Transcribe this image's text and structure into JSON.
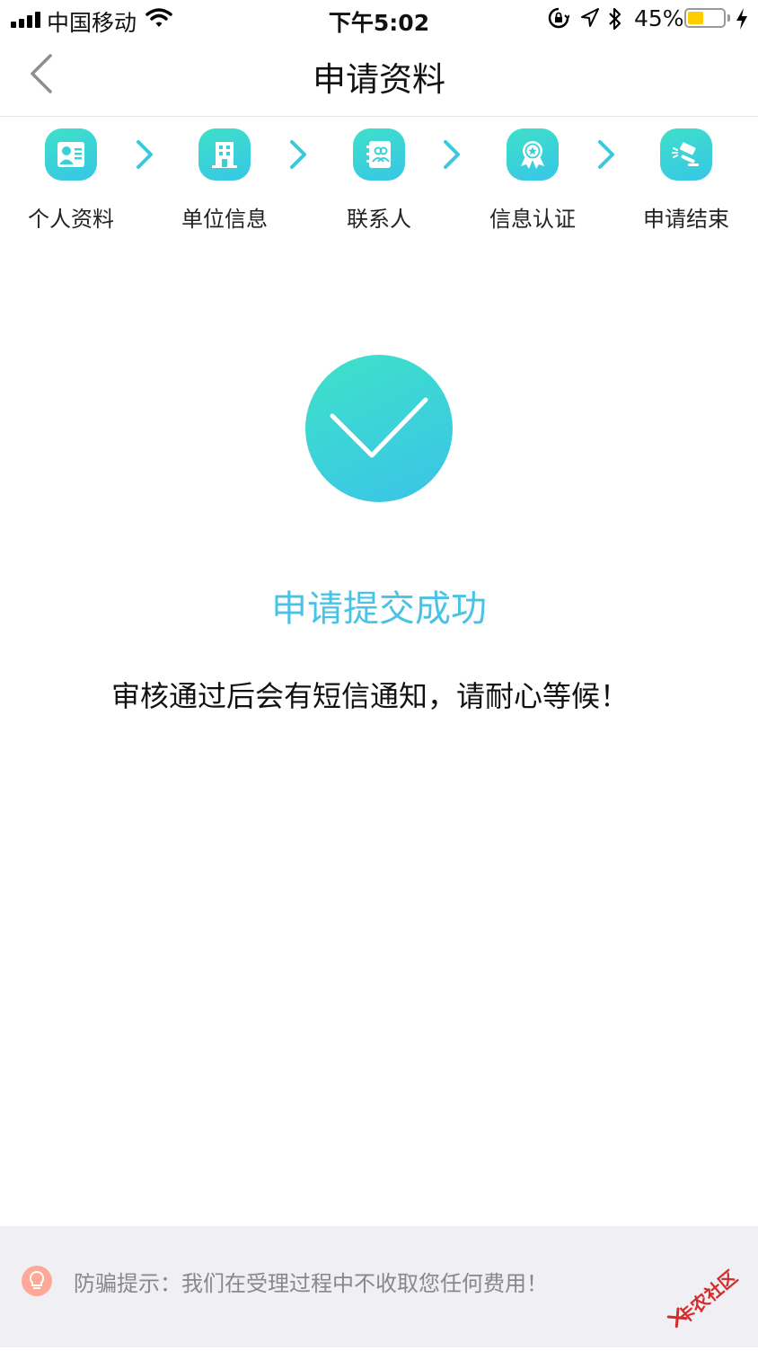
{
  "status_bar": {
    "carrier": "中国移动",
    "time": "下午5:02",
    "battery_percent": "45%",
    "battery_level": 0.45,
    "icons": [
      "signal-icon",
      "wifi-icon",
      "orientation-lock-icon",
      "location-icon",
      "bluetooth-icon",
      "battery-icon",
      "charging-icon"
    ]
  },
  "nav": {
    "title": "申请资料",
    "back_icon": "chevron-left-icon"
  },
  "steps": [
    {
      "label": "个人资料",
      "icon": "id-card-icon"
    },
    {
      "label": "单位信息",
      "icon": "building-icon"
    },
    {
      "label": "联系人",
      "icon": "contacts-book-icon"
    },
    {
      "label": "信息认证",
      "icon": "award-badge-icon"
    },
    {
      "label": "申请结束",
      "icon": "gavel-icon"
    }
  ],
  "success": {
    "icon": "checkmark-icon",
    "title": "申请提交成功",
    "message": "审核通过后会有短信通知，请耐心等候！"
  },
  "footer": {
    "tip_icon": "lightbulb-icon",
    "tip": "防骗提示：我们在受理过程中不收取您任何费用！"
  },
  "watermark": {
    "text": "卡农社区"
  },
  "colors": {
    "accent": "#48c3e6",
    "gradient_start": "#3ee0c9",
    "gradient_end": "#37c6e6",
    "footer_bg": "#efeff4",
    "battery": "#ffcc00"
  }
}
